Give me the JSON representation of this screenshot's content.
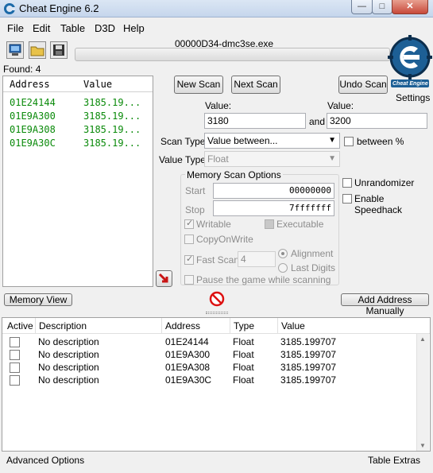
{
  "window": {
    "title": "Cheat Engine 6.2",
    "minimize": "—",
    "maximize": "□",
    "close": "✕"
  },
  "menu": [
    "File",
    "Edit",
    "Table",
    "D3D",
    "Help"
  ],
  "process": "00000D34-dmc3se.exe",
  "found": "Found: 4",
  "logo_text": "Cheat Engine",
  "settings_label": "Settings",
  "results": {
    "columns": [
      "Address",
      "Value"
    ],
    "rows": [
      {
        "address": "01E24144",
        "value": "3185.19..."
      },
      {
        "address": "01E9A300",
        "value": "3185.19..."
      },
      {
        "address": "01E9A308",
        "value": "3185.19..."
      },
      {
        "address": "01E9A30C",
        "value": "3185.19..."
      }
    ]
  },
  "buttons": {
    "new_scan": "New Scan",
    "next_scan": "Next Scan",
    "undo_scan": "Undo Scan",
    "memory_view": "Memory View",
    "add_address": "Add Address Manually"
  },
  "scan": {
    "value_label": "Value:",
    "value1": "3180",
    "and_label": "and",
    "value2_label": "Value:",
    "value2": "3200",
    "scan_type_label": "Scan Type",
    "scan_type": "Value between...",
    "between_pct_label": "between %",
    "value_type_label": "Value Type",
    "value_type": "Float"
  },
  "memory_options": {
    "title": "Memory Scan Options",
    "start_label": "Start",
    "start": "00000000",
    "stop_label": "Stop",
    "stop": "7fffffff",
    "writable": "Writable",
    "executable": "Executable",
    "copy_on_write": "CopyOnWrite",
    "fast_scan": "Fast Scan",
    "fast_scan_value": "4",
    "alignment": "Alignment",
    "last_digits": "Last Digits",
    "pause": "Pause the game while scanning"
  },
  "extras": {
    "unrandomizer": "Unrandomizer",
    "speedhack": "Enable Speedhack"
  },
  "table": {
    "columns": [
      "Active",
      "Description",
      "Address",
      "Type",
      "Value"
    ],
    "rows": [
      {
        "description": "No description",
        "address": "01E24144",
        "type": "Float",
        "value": "3185.199707"
      },
      {
        "description": "No description",
        "address": "01E9A300",
        "type": "Float",
        "value": "3185.199707"
      },
      {
        "description": "No description",
        "address": "01E9A308",
        "type": "Float",
        "value": "3185.199707"
      },
      {
        "description": "No description",
        "address": "01E9A30C",
        "type": "Float",
        "value": "3185.199707"
      }
    ]
  },
  "status": {
    "advanced": "Advanced Options",
    "table_extras": "Table Extras"
  }
}
